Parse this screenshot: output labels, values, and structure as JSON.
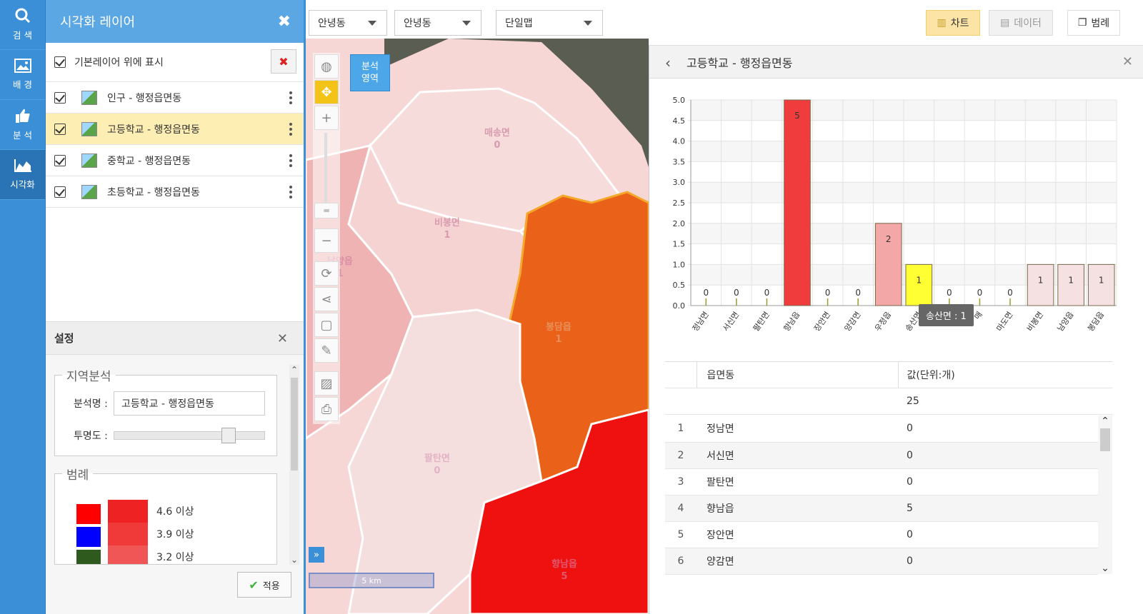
{
  "nav": {
    "items": [
      {
        "label": "검 색",
        "icon": "search-icon"
      },
      {
        "label": "배 경",
        "icon": "image-icon"
      },
      {
        "label": "분 석",
        "icon": "thumbs-up-icon"
      },
      {
        "label": "시각화",
        "icon": "area-chart-icon"
      }
    ]
  },
  "layer_panel": {
    "title": "시각화 레이어",
    "show_on_top_label": "기본레이어 위에 표시",
    "layers": [
      {
        "label": "인구 - 행정읍면동",
        "selected": false
      },
      {
        "label": "고등학교 - 행정읍면동",
        "selected": true
      },
      {
        "label": "중학교 - 행정읍면동",
        "selected": false
      },
      {
        "label": "초등학교 - 행정읍면동",
        "selected": false
      }
    ]
  },
  "settings": {
    "title": "설정",
    "region_legend": "지역분석",
    "name_label": "분석명 :",
    "name_value": "고등학교 - 행정읍면동",
    "opacity_label": "투명도 :",
    "opacity_value": 0.78,
    "legend_title": "범례",
    "legend_colors": [
      "#ff0000",
      "#0000ff",
      "#2f5a1e"
    ],
    "legend_items": [
      {
        "label": "4.6 이상",
        "color": "#ee2222"
      },
      {
        "label": "3.9 이상",
        "color": "#f03a3a"
      },
      {
        "label": "3.2 이상",
        "color": "#f05656"
      }
    ],
    "apply_label": "적용"
  },
  "toolbar": {
    "select1": "안녕동",
    "select2": "안녕동",
    "select3": "단일맵",
    "chart_btn": "차트",
    "data_btn": "데이터",
    "legend_btn": "범례"
  },
  "map": {
    "analysis_area": "분석\n영역",
    "scale": "5 km",
    "regions": [
      {
        "name": "매송면",
        "value": "0"
      },
      {
        "name": "비봉면",
        "value": "1"
      },
      {
        "name": "남양읍",
        "value": "1"
      },
      {
        "name": "봉담읍",
        "value": "1"
      },
      {
        "name": "팔탄면",
        "value": "0"
      },
      {
        "name": "향남읍",
        "value": "5"
      }
    ]
  },
  "right_panel": {
    "title": "고등학교 - 행정읍면동",
    "tooltip": "송산면 : 1",
    "table": {
      "col1": "읍면동",
      "col2": "값(단위:개)",
      "total": "25",
      "rows": [
        {
          "no": "1",
          "name": "정남면",
          "value": "0"
        },
        {
          "no": "2",
          "name": "서신면",
          "value": "0"
        },
        {
          "no": "3",
          "name": "팔탄면",
          "value": "0"
        },
        {
          "no": "4",
          "name": "향남읍",
          "value": "5"
        },
        {
          "no": "5",
          "name": "장안면",
          "value": "0"
        },
        {
          "no": "6",
          "name": "양감면",
          "value": "0"
        }
      ]
    }
  },
  "chart_data": {
    "type": "bar",
    "categories": [
      "정남면",
      "서신면",
      "팔탄면",
      "향남읍",
      "장안면",
      "양감면",
      "우정읍",
      "송산면",
      "새솔동",
      "매송면",
      "마도면",
      "비봉면",
      "남양읍",
      "봉담읍"
    ],
    "tick_labels": [
      "정남면",
      "서신면",
      "팔탄면",
      "향남읍",
      "장안면",
      "양감면",
      "우정읍",
      "송산면",
      "새",
      "매",
      "마도면",
      "비봉면",
      "남양읍",
      "봉담읍"
    ],
    "values": [
      0,
      0,
      0,
      5,
      0,
      0,
      2,
      1,
      0,
      0,
      0,
      1,
      1,
      1
    ],
    "colors": [
      "#cccccc",
      "#cccccc",
      "#cccccc",
      "#f03c3c",
      "#cccccc",
      "#cccccc",
      "#f3a7a7",
      "#ffff33",
      "#cccccc",
      "#cccccc",
      "#cccccc",
      "#f5e1e1",
      "#f5e1e1",
      "#f5e1e1"
    ],
    "ylim": [
      0,
      5
    ],
    "yticks": [
      "5.0",
      "4.5",
      "4.0",
      "3.5",
      "3.0",
      "2.5",
      "2.0",
      "1.5",
      "1.0",
      "0.5",
      "0.0"
    ],
    "grid": true
  }
}
